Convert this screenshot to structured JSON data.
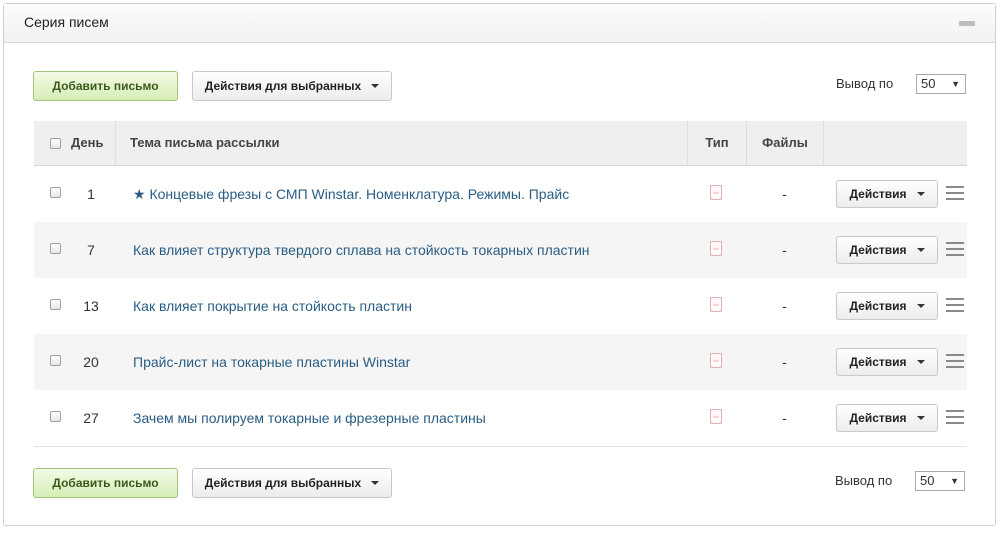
{
  "panel": {
    "title": "Серия писем"
  },
  "toolbar": {
    "add_label": "Добавить письмо",
    "bulk_label": "Действия для выбранных",
    "perpage_label": "Вывод по",
    "perpage_value": "50"
  },
  "table": {
    "headers": {
      "day": "День",
      "subject": "Тема письма рассылки",
      "type": "Тип",
      "files": "Файлы"
    },
    "rows": [
      {
        "day": "1",
        "subject": "★ Концевые фрезы с СМП Winstar. Номенклатура. Режимы. Прайс",
        "files": "-",
        "actions": "Действия"
      },
      {
        "day": "7",
        "subject": "Как влияет структура твердого сплава на стойкость токарных пластин",
        "files": "-",
        "actions": "Действия"
      },
      {
        "day": "13",
        "subject": "Как влияет покрытие на стойкость пластин",
        "files": "-",
        "actions": "Действия"
      },
      {
        "day": "20",
        "subject": "Прайс-лист на токарные пластины Winstar",
        "files": "-",
        "actions": "Действия"
      },
      {
        "day": "27",
        "subject": "Зачем мы полируем токарные и фрезерные пластины",
        "files": "-",
        "actions": "Действия"
      }
    ]
  },
  "icons": {
    "type": "html-file-icon",
    "drag": "drag-handle-icon",
    "collapse": "collapse-icon"
  }
}
